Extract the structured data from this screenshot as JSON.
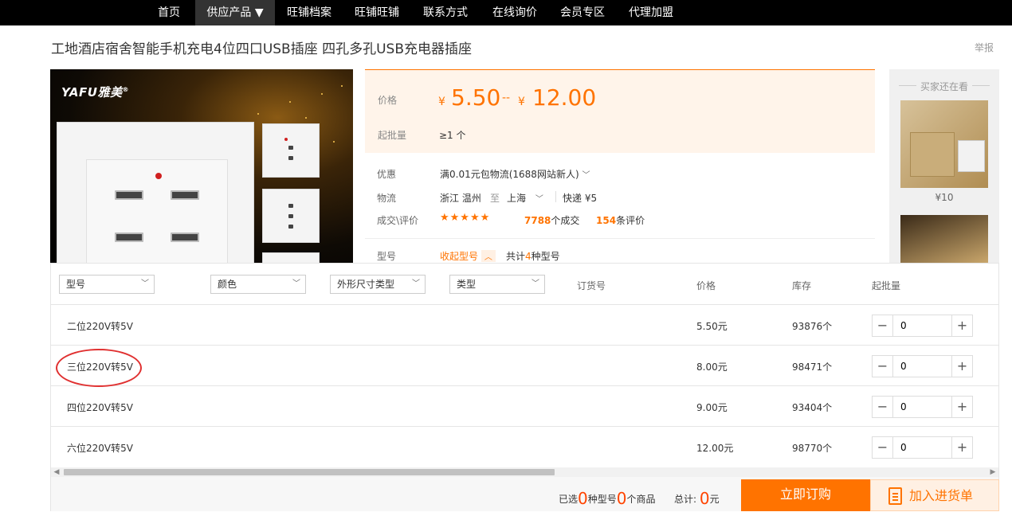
{
  "nav": {
    "items": [
      {
        "label": "首页"
      },
      {
        "label": "供应产品 ▼"
      },
      {
        "label": "旺铺档案"
      },
      {
        "label": "旺铺旺铺"
      },
      {
        "label": "联系方式"
      },
      {
        "label": "在线询价"
      },
      {
        "label": "会员专区"
      },
      {
        "label": "代理加盟"
      }
    ]
  },
  "product": {
    "title": "工地酒店宿舍智能手机充电4位四口USB插座 四孔多孔USB充电器插座",
    "report": "举报",
    "brand": "YAFU雅美",
    "brand_mark": "®"
  },
  "price": {
    "label": "价格",
    "currency": "¥",
    "low": "5.50",
    "separator": "--",
    "high": "12.00",
    "moq_label": "起批量",
    "moq_value": "≥1 个"
  },
  "info": {
    "discount_label": "优惠",
    "discount_value": "满0.01元包物流(1688网站新人)",
    "logistics_label": "物流",
    "from": "浙江 温州",
    "to_word": "至",
    "to": "上海",
    "express": "快递 ¥5",
    "deals_label": "成交\\评价",
    "stars": "★★★★★",
    "deal_count": "7788",
    "deal_suffix": "个成交",
    "review_count": "154",
    "review_suffix": "条评价",
    "model_label": "型号",
    "collapse_label": "收起型号",
    "total_prefix": "共计",
    "total_count": "4",
    "total_suffix": "种型号"
  },
  "side": {
    "title": "买家还在看",
    "item_price": "¥10"
  },
  "table": {
    "filters": [
      "型号",
      "颜色",
      "外形尺寸类型",
      "类型"
    ],
    "headers": [
      "订货号",
      "价格",
      "库存",
      "起批量"
    ],
    "rows": [
      {
        "model": "二位220V转5V",
        "price": "5.50元",
        "stock": "93876个",
        "qty": "0"
      },
      {
        "model": "三位220V转5V",
        "price": "8.00元",
        "stock": "98471个",
        "qty": "0"
      },
      {
        "model": "四位220V转5V",
        "price": "9.00元",
        "stock": "93404个",
        "qty": "0"
      },
      {
        "model": "六位220V转5V",
        "price": "12.00元",
        "stock": "98770个",
        "qty": "0"
      }
    ]
  },
  "footer": {
    "selected_prefix": "已选",
    "models_count": "0",
    "models_suffix": "种型号",
    "items_count": "0",
    "items_suffix": "个商品",
    "total_label": "总计:",
    "total_value": "0",
    "total_unit": "元",
    "buy_label": "立即订购",
    "cart_label": "加入进货单"
  },
  "colors": {
    "accent": "#ff7300",
    "nav_bg": "#000000",
    "highlight": "#e03030"
  }
}
